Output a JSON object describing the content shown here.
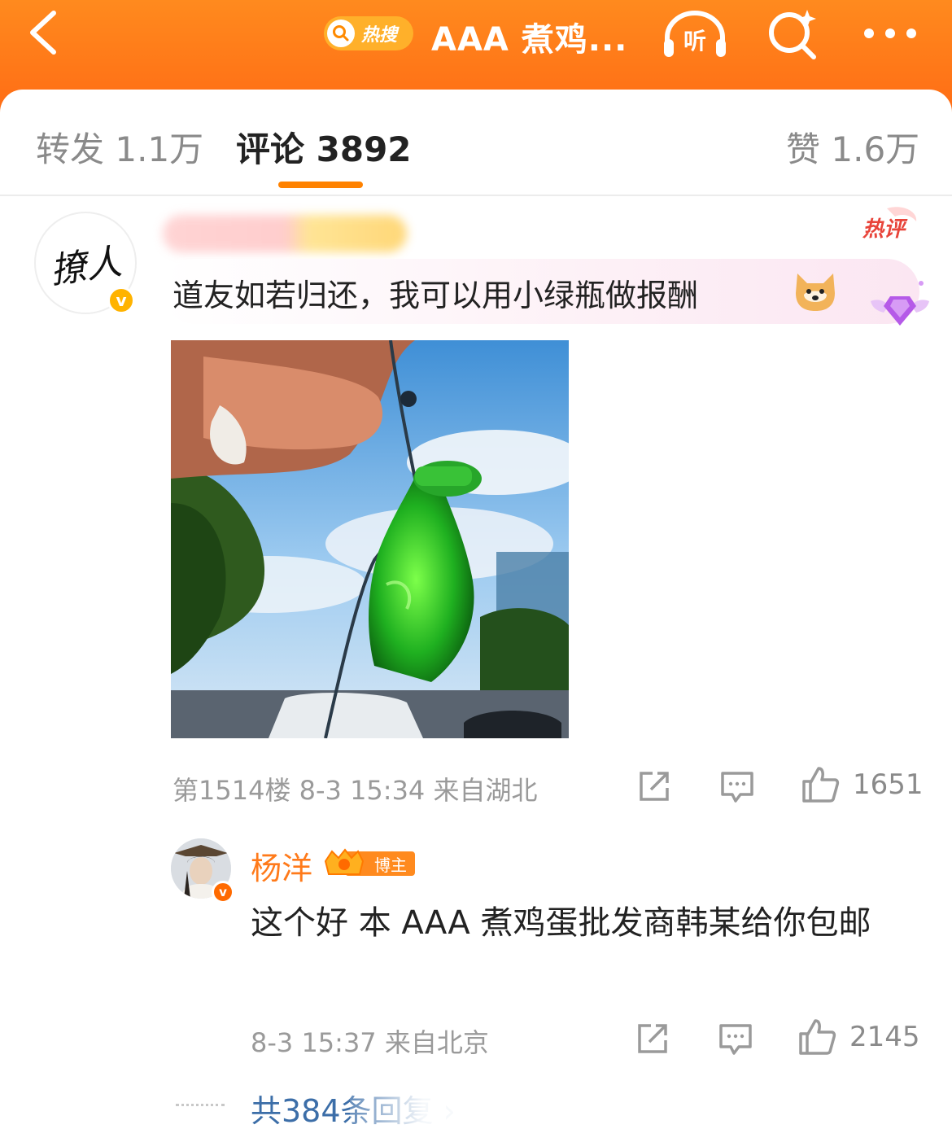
{
  "header": {
    "hot_search_label": "热搜",
    "title": "AAA 煮鸡...",
    "listen_label": "听",
    "brand_color": "#ff7a18"
  },
  "tabs": {
    "repost": {
      "label": "转发",
      "count": "1.1万"
    },
    "comment": {
      "label": "评论",
      "count": "3892"
    },
    "like": {
      "label": "赞",
      "count": "1.6万"
    }
  },
  "comment": {
    "avatar_text": "撩人",
    "hot_label": "热评",
    "text": "道友如若归还，我可以用小绿瓶做报酬",
    "floor": "第1514楼",
    "time": "8-3 15:34",
    "location": "来自湖北",
    "likes": "1651"
  },
  "reply": {
    "name": "杨洋",
    "badge": "博主",
    "text": "这个好 本 AAA 煮鸡蛋批发商韩某给你包邮",
    "time": "8-3 15:37",
    "location": "来自北京",
    "likes": "2145"
  },
  "more_replies": "共384条回复 ›"
}
